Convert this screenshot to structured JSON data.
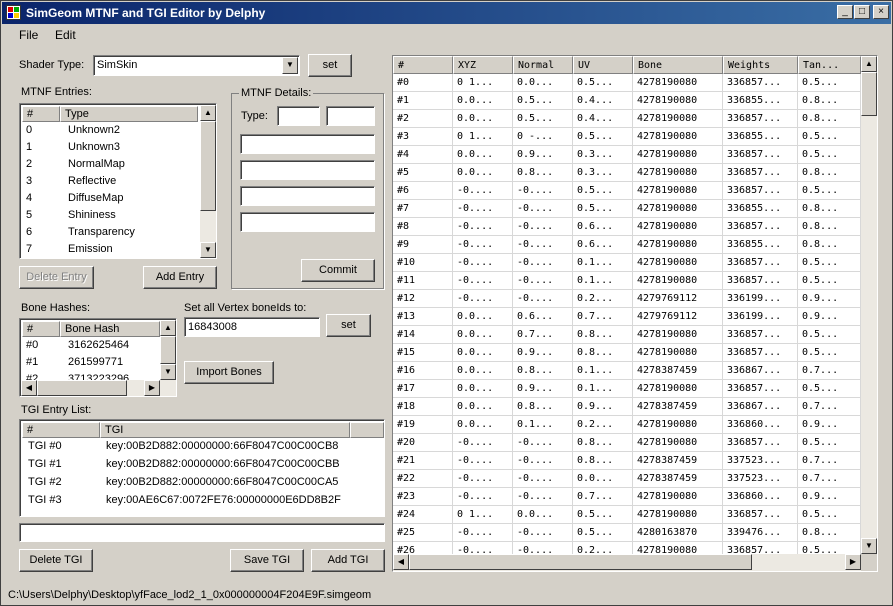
{
  "window": {
    "title": "SimGeom MTNF and TGI Editor by Delphy",
    "controls": {
      "minimize": "_",
      "maximize": "□",
      "close": "×"
    }
  },
  "menu": {
    "file": "File",
    "edit": "Edit"
  },
  "shader": {
    "label": "Shader Type:",
    "value": "SimSkin",
    "set_label": "set"
  },
  "mtnf_entries": {
    "label": "MTNF Entries:",
    "columns": [
      "#",
      "Type"
    ],
    "rows": [
      {
        "num": "0",
        "type": "Unknown2"
      },
      {
        "num": "1",
        "type": "Unknown3"
      },
      {
        "num": "2",
        "type": "NormalMap"
      },
      {
        "num": "3",
        "type": "Reflective"
      },
      {
        "num": "4",
        "type": "DiffuseMap"
      },
      {
        "num": "5",
        "type": "Shininess"
      },
      {
        "num": "6",
        "type": "Transparency"
      },
      {
        "num": "7",
        "type": "Emission"
      }
    ],
    "delete_label": "Delete Entry",
    "add_label": "Add Entry"
  },
  "mtnf_details": {
    "label": "MTNF Details:",
    "type_label": "Type:",
    "commit_label": "Commit"
  },
  "bone_hashes": {
    "label": "Bone Hashes:",
    "columns": [
      "#",
      "Bone Hash"
    ],
    "rows": [
      {
        "num": "#0",
        "hash": "3162625464"
      },
      {
        "num": "#1",
        "hash": "261599771"
      },
      {
        "num": "#2",
        "hash": "3713223296"
      }
    ]
  },
  "vertex_bones": {
    "label": "Set all Vertex boneIds to:",
    "value": "16843008",
    "set_label": "set",
    "import_label": "Import Bones"
  },
  "tgi": {
    "label": "TGI Entry List:",
    "columns": [
      "#",
      "TGI"
    ],
    "rows": [
      {
        "num": "TGI #0",
        "tgi": "key:00B2D882:00000000:66F8047C00C00CB8"
      },
      {
        "num": "TGI #1",
        "tgi": "key:00B2D882:00000000:66F8047C00C00CBB"
      },
      {
        "num": "TGI #2",
        "tgi": "key:00B2D882:00000000:66F8047C00C00CA5"
      },
      {
        "num": "TGI #3",
        "tgi": "key:00AE6C67:0072FE76:00000000E6DD8B2F"
      }
    ],
    "delete_label": "Delete TGI",
    "save_label": "Save TGI",
    "add_label": "Add TGI"
  },
  "vertex_grid": {
    "columns": [
      "#",
      "XYZ",
      "Normal",
      "UV",
      "Bone",
      "Weights",
      "Tan..."
    ],
    "rows": [
      [
        "#0",
        "0 1...",
        "0.0...",
        "0.5...",
        "4278190080",
        "336857...",
        "0.5..."
      ],
      [
        "#1",
        "0.0...",
        "0.5...",
        "0.4...",
        "4278190080",
        "336855...",
        "0.8..."
      ],
      [
        "#2",
        "0.0...",
        "0.5...",
        "0.4...",
        "4278190080",
        "336857...",
        "0.8..."
      ],
      [
        "#3",
        "0 1...",
        "0 -...",
        "0.5...",
        "4278190080",
        "336855...",
        "0.5..."
      ],
      [
        "#4",
        "0.0...",
        "0.9...",
        "0.3...",
        "4278190080",
        "336857...",
        "0.5..."
      ],
      [
        "#5",
        "0.0...",
        "0.8...",
        "0.3...",
        "4278190080",
        "336857...",
        "0.8..."
      ],
      [
        "#6",
        "-0....",
        "-0....",
        "0.5...",
        "4278190080",
        "336857...",
        "0.5..."
      ],
      [
        "#7",
        "-0....",
        "-0....",
        "0.5...",
        "4278190080",
        "336855...",
        "0.8..."
      ],
      [
        "#8",
        "-0....",
        "-0....",
        "0.6...",
        "4278190080",
        "336857...",
        "0.8..."
      ],
      [
        "#9",
        "-0....",
        "-0....",
        "0.6...",
        "4278190080",
        "336855...",
        "0.8..."
      ],
      [
        "#10",
        "-0....",
        "-0....",
        "0.1...",
        "4278190080",
        "336857...",
        "0.5..."
      ],
      [
        "#11",
        "-0....",
        "-0....",
        "0.1...",
        "4278190080",
        "336857...",
        "0.5..."
      ],
      [
        "#12",
        "-0....",
        "-0....",
        "0.2...",
        "4279769112",
        "336199...",
        "0.9..."
      ],
      [
        "#13",
        "0.0...",
        "0.6...",
        "0.7...",
        "4279769112",
        "336199...",
        "0.9..."
      ],
      [
        "#14",
        "0.0...",
        "0.7...",
        "0.8...",
        "4278190080",
        "336857...",
        "0.5..."
      ],
      [
        "#15",
        "0.0...",
        "0.9...",
        "0.8...",
        "4278190080",
        "336857...",
        "0.5..."
      ],
      [
        "#16",
        "0.0...",
        "0.8...",
        "0.1...",
        "4278387459",
        "336867...",
        "0.7..."
      ],
      [
        "#17",
        "0.0...",
        "0.9...",
        "0.1...",
        "4278190080",
        "336857...",
        "0.5..."
      ],
      [
        "#18",
        "0.0...",
        "0.8...",
        "0.9...",
        "4278387459",
        "336867...",
        "0.7..."
      ],
      [
        "#19",
        "0.0...",
        "0.1...",
        "0.2...",
        "4278190080",
        "336860...",
        "0.9..."
      ],
      [
        "#20",
        "-0....",
        "-0....",
        "0.8...",
        "4278190080",
        "336857...",
        "0.5..."
      ],
      [
        "#21",
        "-0....",
        "-0....",
        "0.8...",
        "4278387459",
        "337523...",
        "0.7..."
      ],
      [
        "#22",
        "-0....",
        "-0....",
        "0.0...",
        "4278387459",
        "337523...",
        "0.7..."
      ],
      [
        "#23",
        "-0....",
        "-0....",
        "0.7...",
        "4278190080",
        "336860...",
        "0.9..."
      ],
      [
        "#24",
        "0 1...",
        "0.0...",
        "0.5...",
        "4278190080",
        "336857...",
        "0.5..."
      ],
      [
        "#25",
        "-0....",
        "-0....",
        "0.5...",
        "4280163870",
        "339476...",
        "0.8..."
      ],
      [
        "#26",
        "-0....",
        "-0....",
        "0.2...",
        "4278190080",
        "336857...",
        "0.5..."
      ]
    ]
  },
  "status": {
    "path": "C:\\Users\\Delphy\\Desktop\\yfFace_lod2_1_0x000000004F204E9F.simgeom"
  }
}
